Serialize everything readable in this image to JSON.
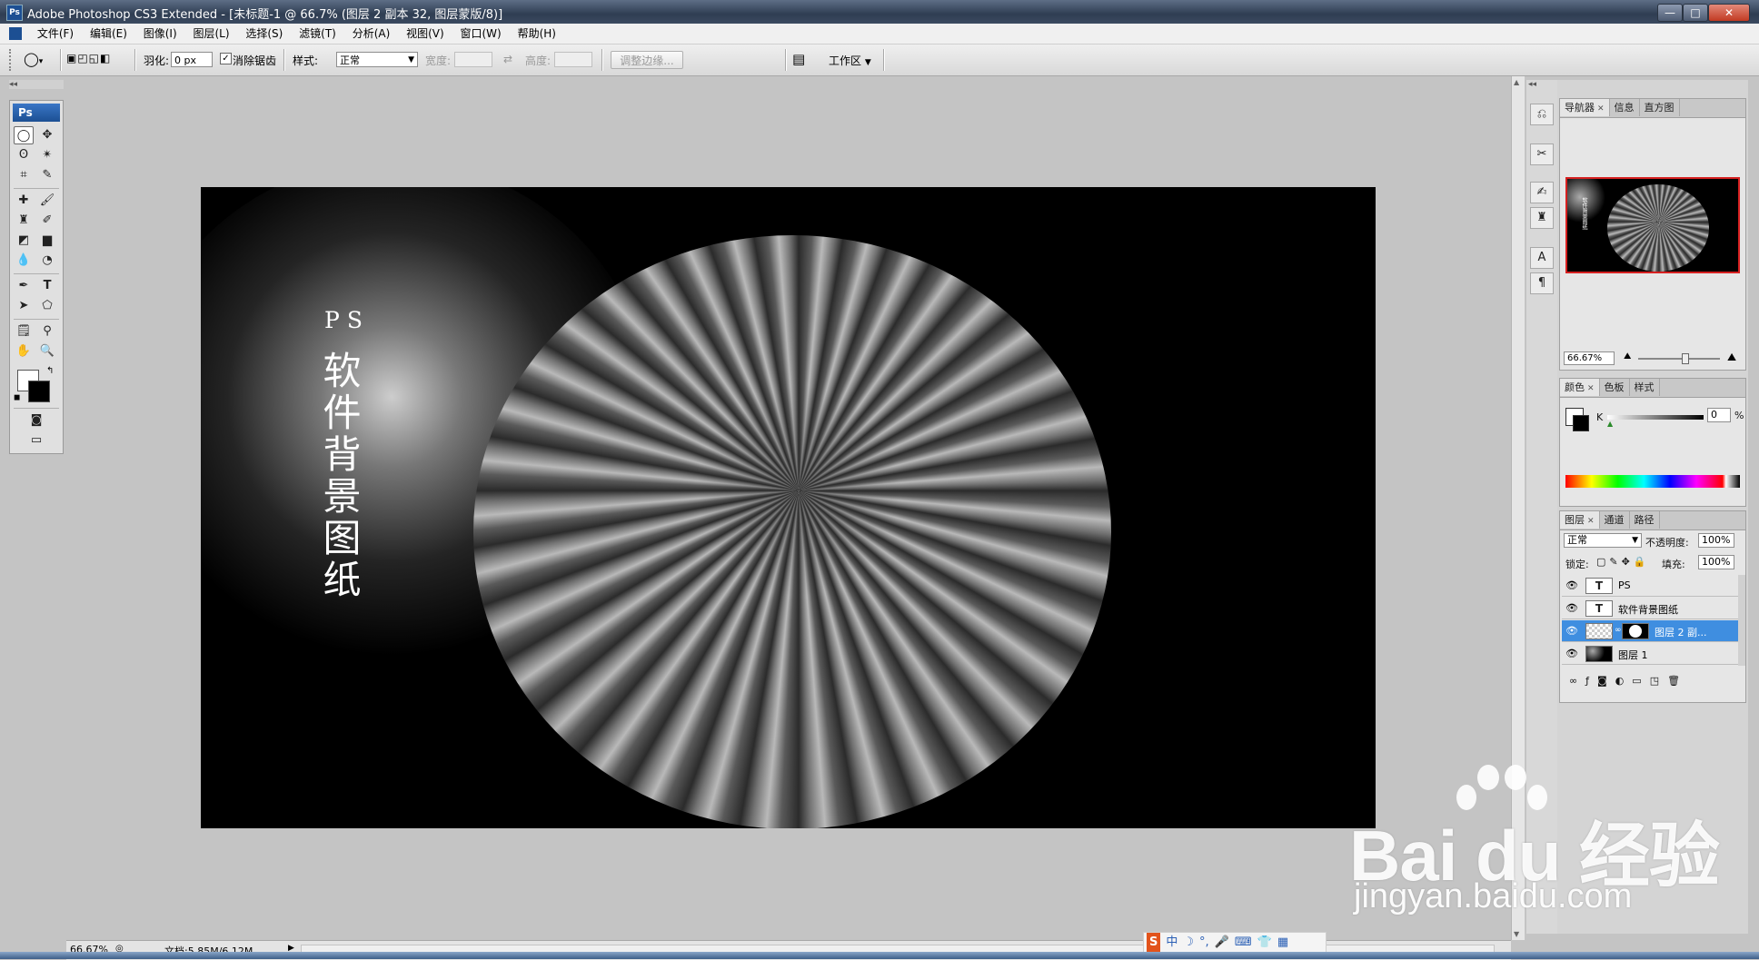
{
  "window": {
    "title": "Adobe Photoshop CS3 Extended - [未标题-1 @ 66.7% (图层 2 副本 32, 图层蒙版/8)]",
    "app_icon": "Ps",
    "controls": {
      "minimize": "—",
      "maximize": "□",
      "close": "✕"
    },
    "doc_controls": {
      "minimize": "_",
      "restore": "▫",
      "close": "✕"
    }
  },
  "menubar": {
    "items": [
      "文件(F)",
      "编辑(E)",
      "图像(I)",
      "图层(L)",
      "选择(S)",
      "滤镜(T)",
      "分析(A)",
      "视图(V)",
      "窗口(W)",
      "帮助(H)"
    ]
  },
  "options": {
    "feather_label": "羽化:",
    "feather_value": "0 px",
    "antialias_label": "消除锯齿",
    "antialias_checked": true,
    "style_label": "样式:",
    "style_value": "正常",
    "width_label": "宽度:",
    "height_label": "高度:",
    "refine_edge_label": "调整边缘...",
    "workspace_label": "工作区"
  },
  "artwork": {
    "top_text": "PS",
    "vertical_text": "软件背景图纸"
  },
  "panels": {
    "navigator": {
      "tabs": [
        "导航器",
        "信息",
        "直方图"
      ],
      "zoom": "66.67%"
    },
    "color": {
      "tabs": [
        "颜色",
        "色板",
        "样式"
      ],
      "channel_label": "K",
      "value": "0",
      "unit": "%"
    },
    "layers": {
      "tabs": [
        "图层",
        "通道",
        "路径"
      ],
      "blend_mode": "正常",
      "opacity_label": "不透明度:",
      "opacity_value": "100%",
      "lock_label": "锁定:",
      "fill_label": "填充:",
      "fill_value": "100%",
      "items": [
        {
          "name": "PS",
          "type": "text",
          "selected": false
        },
        {
          "name": "软件背景图纸",
          "type": "text",
          "selected": false
        },
        {
          "name": "图层 2 副...",
          "type": "masked",
          "selected": true
        },
        {
          "name": "图层 1",
          "type": "image",
          "selected": false
        }
      ]
    }
  },
  "status": {
    "zoom": "66.67%",
    "doc_size": "文档:5.85M/6.12M"
  },
  "ime": {
    "items": [
      "S",
      "中",
      "☽",
      "°,",
      "🎤",
      "⌨",
      "👕",
      "▦"
    ]
  },
  "watermark": {
    "brand": "Bai du 经验",
    "url": "jingyan.baidu.com"
  }
}
